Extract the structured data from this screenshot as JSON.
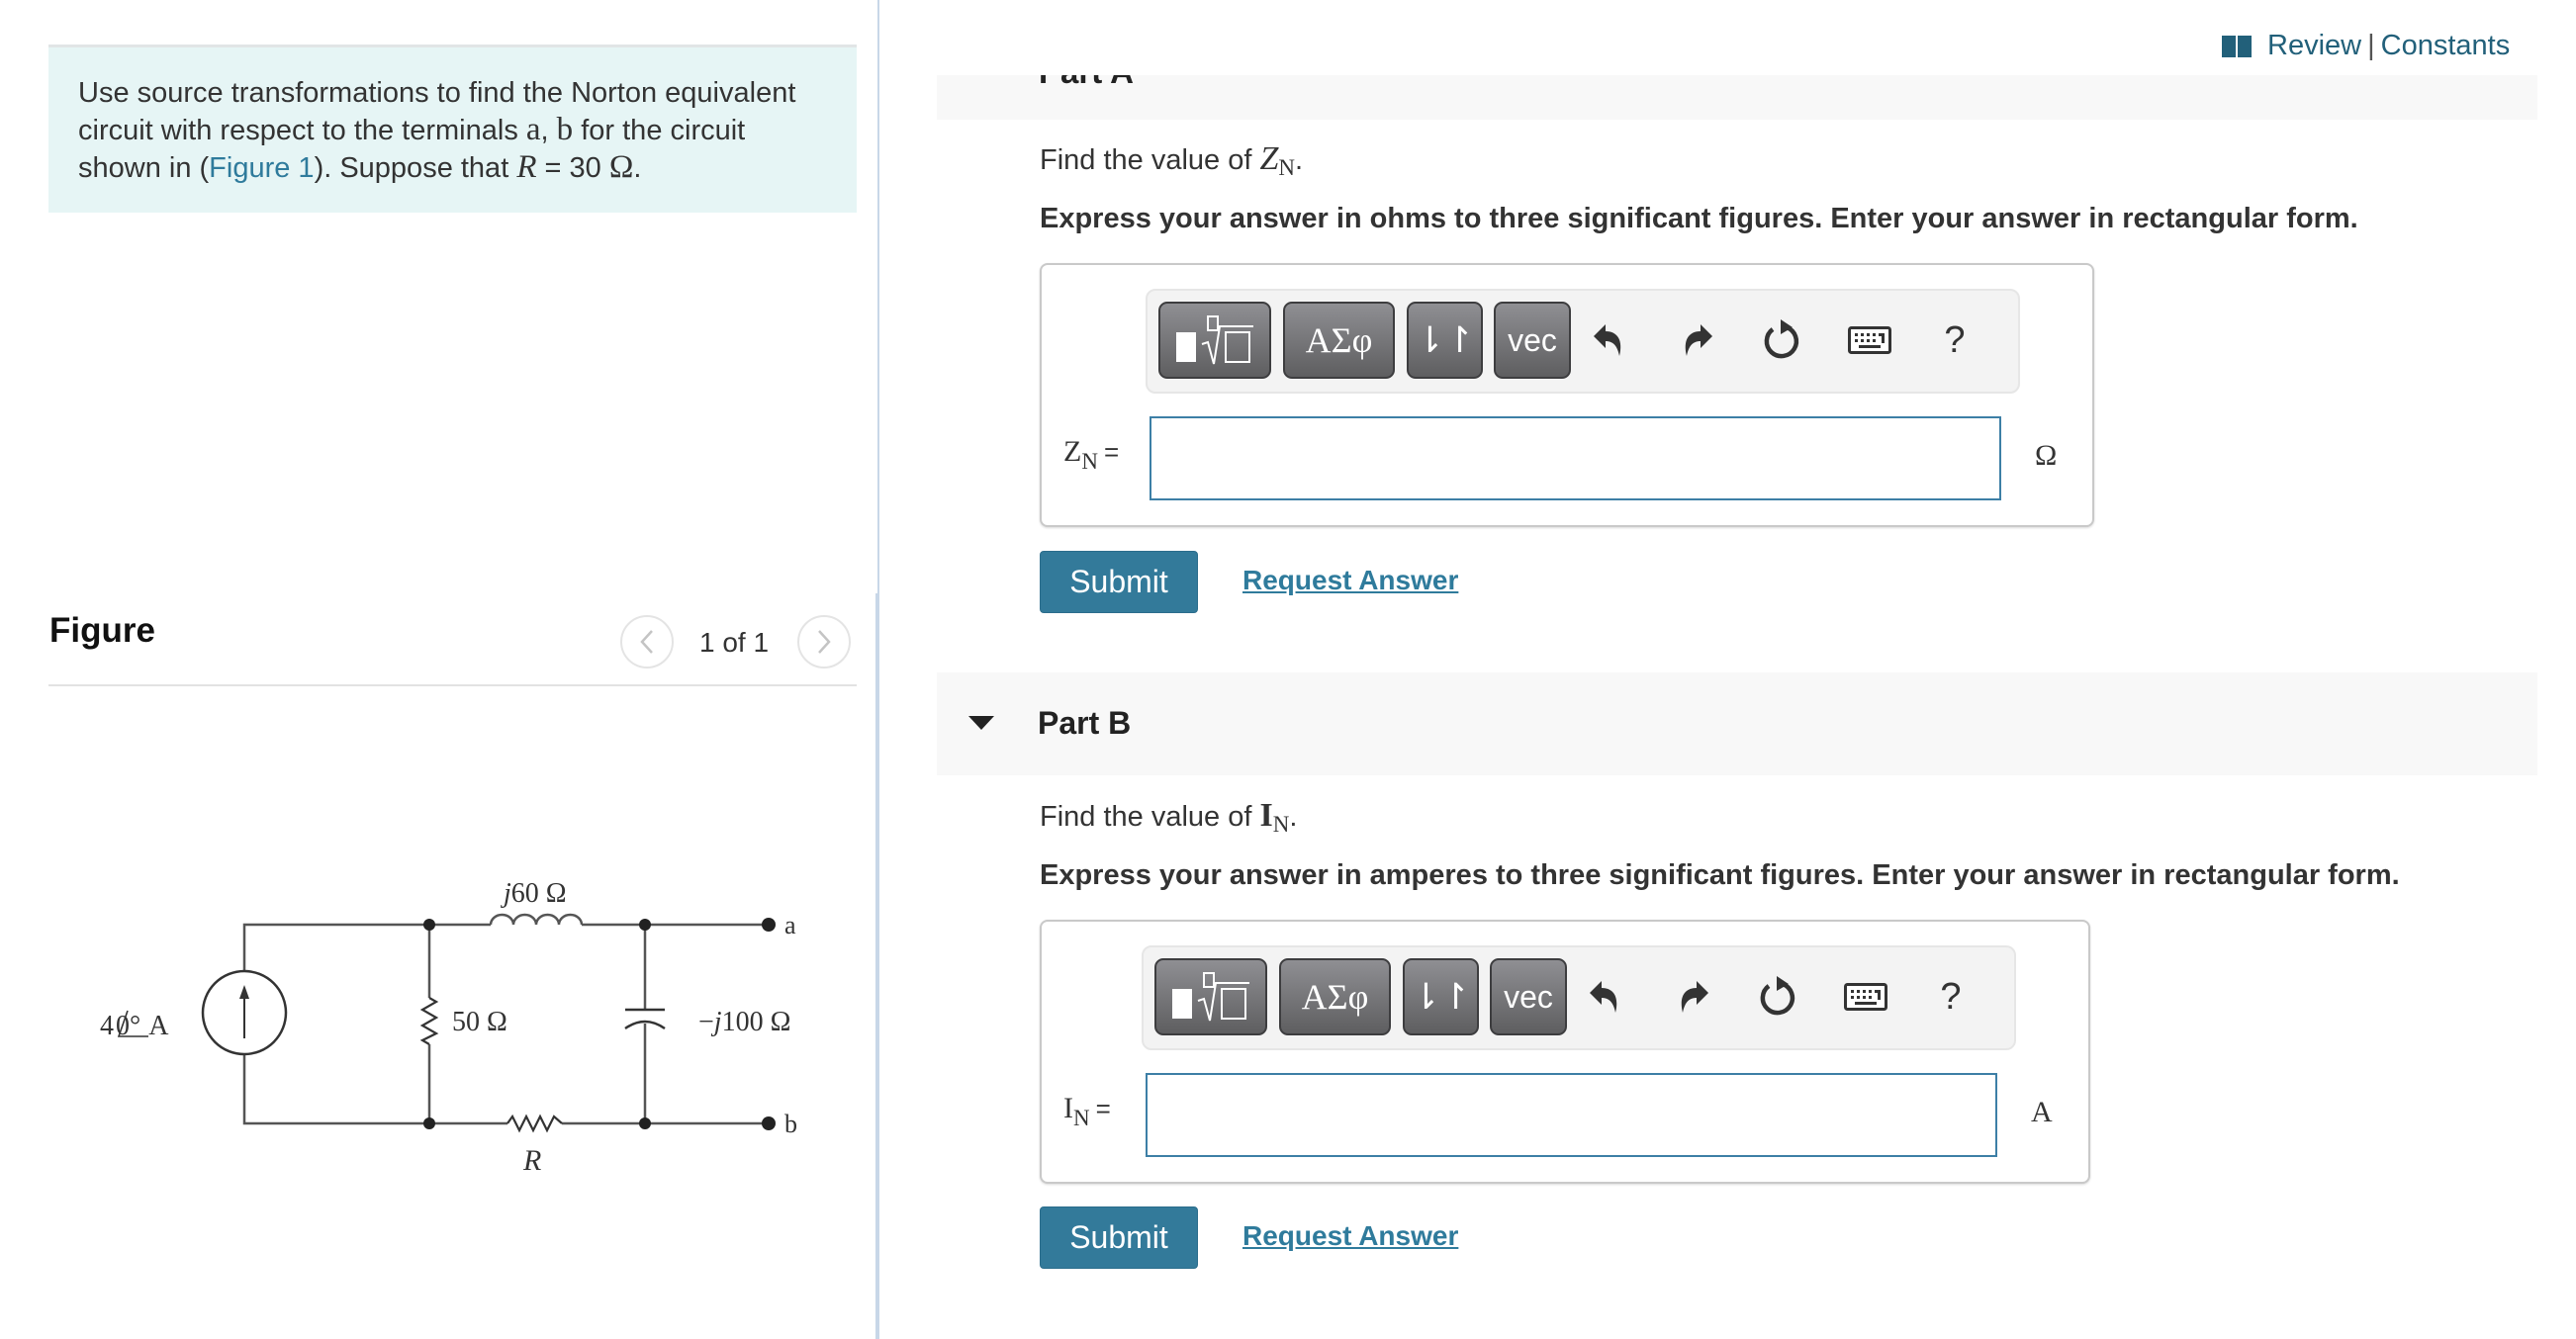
{
  "header": {
    "review_label": "Review",
    "separator": "|",
    "constants_label": "Constants",
    "link_color": "#22607a"
  },
  "problem": {
    "text_before_terms": "Use source transformations to find the Norton equivalent circuit with respect to the terminals ",
    "terminal_a": "a",
    "comma": ", ",
    "terminal_b": "b",
    "text_after_terms": " for the circuit shown in (",
    "figure_link": "Figure 1",
    "text_after_link": "). Suppose that ",
    "var_R": "R",
    "equals_value": " = 30 ",
    "ohm": "Ω",
    "period": "."
  },
  "figure": {
    "title": "Figure",
    "pager": "1 of 1",
    "prev_icon": "chevron-left-icon",
    "next_icon": "chevron-right-icon",
    "circuit": {
      "source_label_mag": "4",
      "source_label_angle": "0°",
      "source_label_unit": "A",
      "inductor_label_j": "j",
      "inductor_label_val": "60 Ω",
      "resistor50_label": "50 Ω",
      "capacitor_label_prefix": "−",
      "capacitor_label_j": "j",
      "capacitor_label_val": "100 Ω",
      "resistorR_label": "R",
      "terminal_a": "a",
      "terminal_b": "b"
    }
  },
  "parts": [
    {
      "title": "Part A",
      "prompt_prefix": "Find the value of ",
      "var": "Z",
      "var_sub": "N",
      "prompt_suffix": ".",
      "instructions": "Express your answer in ohms to three significant figures. Enter your answer in rectangular form.",
      "answer_label_var": "Z",
      "answer_label_sub": "N",
      "answer_label_eq": "=",
      "answer_value": "",
      "unit": "Ω",
      "submit_label": "Submit",
      "request_label": "Request Answer"
    },
    {
      "title": "Part B",
      "prompt_prefix": "Find the value of ",
      "var": "I",
      "var_sub": "N",
      "prompt_suffix": ".",
      "instructions": "Express your answer in amperes to three significant figures. Enter your answer in rectangular form.",
      "answer_label_var": "I",
      "answer_label_sub": "N",
      "answer_label_eq": "=",
      "answer_value": "",
      "unit": "A",
      "submit_label": "Submit",
      "request_label": "Request Answer"
    }
  ],
  "toolbar": {
    "greek_label": "ΑΣφ",
    "arrows_label": "⇂↾",
    "vec_label": "vec",
    "help_label": "?",
    "icons": [
      "templates-icon",
      "greek-icon",
      "subscript-superscript-icon",
      "vec-icon",
      "undo-icon",
      "redo-icon",
      "reset-icon",
      "keyboard-icon",
      "help-icon"
    ]
  },
  "colors": {
    "accent": "#337a9a",
    "link": "#2f7b9c",
    "info_bg": "#e6f5f5",
    "header_bg": "#f8f8f8"
  }
}
